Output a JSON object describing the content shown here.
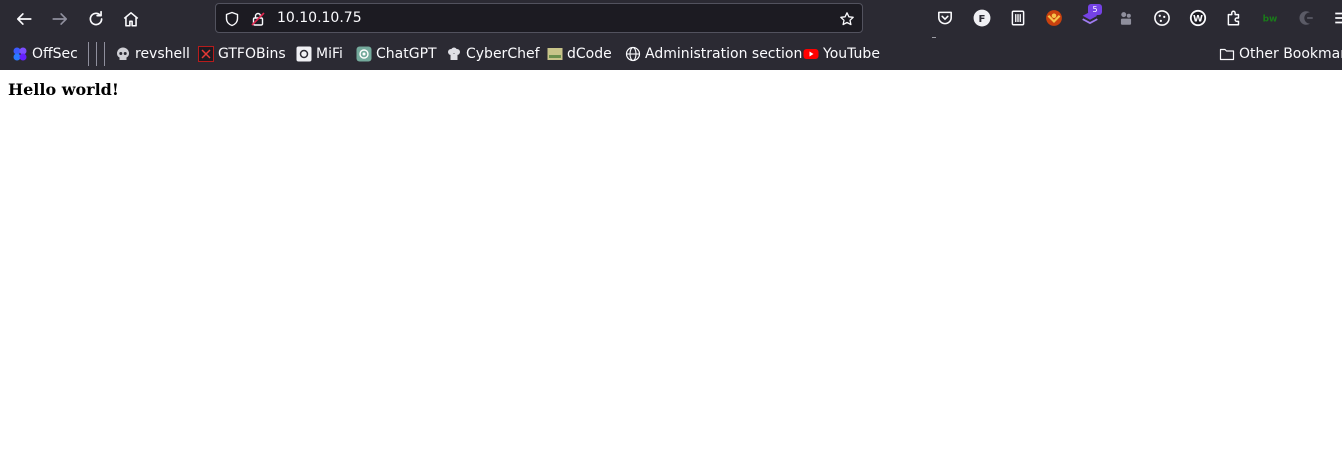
{
  "toolbar": {
    "back": {
      "icon": "back-arrow-icon"
    },
    "forward": {
      "icon": "forward-arrow-icon"
    },
    "reload": {
      "icon": "reload-icon"
    },
    "home": {
      "icon": "home-icon"
    }
  },
  "urlbar": {
    "url": "10.10.10.75",
    "shield_icon": "tracking-protection-shield-icon",
    "lock_icon": "insecure-lock-icon",
    "star_icon": "bookmark-star-icon"
  },
  "extensions": {
    "items": [
      {
        "icon": "pocket-icon"
      },
      {
        "icon": "fakefiller-icon",
        "label": "F"
      },
      {
        "icon": "trash-icon"
      },
      {
        "icon": "foxyproxy-icon"
      },
      {
        "icon": "wappalyzer-icon",
        "badge": "5"
      },
      {
        "icon": "puzzle-extension-icon"
      },
      {
        "icon": "cookie-icon"
      },
      {
        "icon": "wordpress-icon",
        "label": "W"
      },
      {
        "icon": "extensions-icon"
      },
      {
        "icon": "builtwith-icon",
        "label": "bw"
      },
      {
        "icon": "dark-reader-icon"
      },
      {
        "icon": "menu-icon"
      }
    ]
  },
  "bookmarks": {
    "items": [
      {
        "label": "OffSec",
        "icon": "offsec-icon"
      },
      {
        "label": "revshell",
        "icon": "skull-icon"
      },
      {
        "label": "GTFOBins",
        "icon": "gtfobins-icon"
      },
      {
        "label": "MiFi",
        "icon": "mifi-icon"
      },
      {
        "label": "ChatGPT",
        "icon": "chatgpt-icon"
      },
      {
        "label": "CyberChef",
        "icon": "chef-hat-icon"
      },
      {
        "label": "dCode",
        "icon": "dcode-icon"
      },
      {
        "label": "Administration section",
        "icon": "globe-icon"
      },
      {
        "label": "YouTube",
        "icon": "youtube-icon"
      }
    ],
    "other": {
      "label": "Other Bookmarks",
      "icon": "folder-icon"
    }
  },
  "page": {
    "heading": "Hello world!"
  },
  "colors": {
    "toolbar_bg": "#2b2a33",
    "urlbar_bg": "#1c1b22",
    "text": "#fbfbfe",
    "page_bg": "#ffffff"
  }
}
